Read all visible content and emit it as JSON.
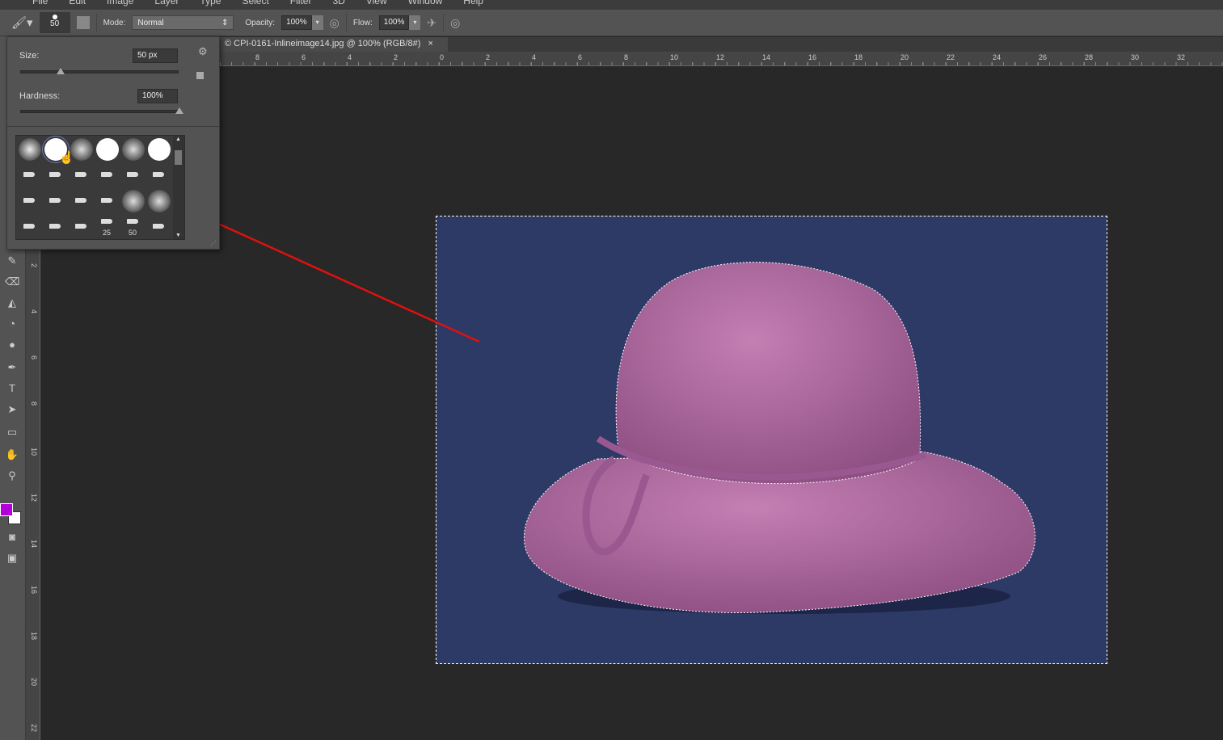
{
  "menu": [
    "File",
    "Edit",
    "Image",
    "Layer",
    "Type",
    "Select",
    "Filter",
    "3D",
    "View",
    "Window",
    "Help"
  ],
  "options": {
    "brush_size": "50",
    "mode_label": "Mode:",
    "mode_value": "Normal",
    "opacity_label": "Opacity:",
    "opacity_value": "100%",
    "flow_label": "Flow:",
    "flow_value": "100%"
  },
  "document": {
    "tab_title": "© CPI-0161-Inlineimage14.jpg @ 100% (RGB/8#)",
    "close": "×"
  },
  "brush_panel": {
    "size_label": "Size:",
    "size_value": "50 px",
    "size_fraction": 0.25,
    "hardness_label": "Hardness:",
    "hardness_value": "100%",
    "hardness_fraction": 1.0,
    "preset_labels": [
      "25",
      "50"
    ]
  },
  "ruler": {
    "horizontal": [
      "8",
      "6",
      "4",
      "2",
      "0",
      "2",
      "4",
      "6",
      "8",
      "10",
      "12",
      "14",
      "16",
      "18",
      "20",
      "22",
      "24",
      "26",
      "28",
      "30",
      "32"
    ],
    "vertical": [
      "2",
      "4",
      "6",
      "8",
      "10",
      "12",
      "14",
      "16",
      "18",
      "20",
      "22"
    ]
  },
  "colors": {
    "foreground": "#b400d8",
    "background": "#ffffff",
    "image_bg": "#2e3a66",
    "hat": "#b06a9e",
    "arrow": "#e01010"
  }
}
